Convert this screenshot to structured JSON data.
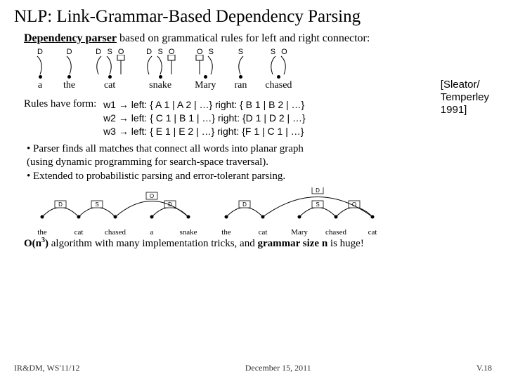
{
  "title": "NLP: Link-Grammar-Based Dependency Parsing",
  "subtitle_bold": "Dependency parser",
  "subtitle_rest": " based on grammatical rules for left and right connector:",
  "citation": "[Sleator/\nTemperley\n1991]",
  "words_row1": [
    {
      "label": "a",
      "conns": [
        {
          "dir": "r",
          "lbl": "D"
        }
      ]
    },
    {
      "label": "the",
      "conns": [
        {
          "dir": "r",
          "lbl": "D"
        }
      ]
    },
    {
      "label": "cat",
      "conns": [
        {
          "dir": "l",
          "lbl": "D"
        },
        {
          "dir": "r",
          "lbl": "S"
        },
        {
          "dir": "top",
          "lbl": "O"
        }
      ]
    },
    {
      "label": "snake",
      "conns": [
        {
          "dir": "l",
          "lbl": "D"
        },
        {
          "dir": "r",
          "lbl": "S"
        },
        {
          "dir": "top",
          "lbl": "O"
        }
      ]
    },
    {
      "label": "Mary",
      "conns": [
        {
          "dir": "top",
          "lbl": "O"
        },
        {
          "dir": "r",
          "lbl": "S"
        }
      ]
    },
    {
      "label": "ran",
      "conns": [
        {
          "dir": "l",
          "lbl": "S"
        }
      ]
    },
    {
      "label": "chased",
      "conns": [
        {
          "dir": "l",
          "lbl": "S"
        },
        {
          "dir": "r",
          "lbl": "O"
        }
      ]
    }
  ],
  "rules_lead": "Rules have form:",
  "rules": [
    "w1 → left: { A 1 | A 2 | …}  right: { B 1 | B 2 | …}",
    "w2 → left: { C 1 | B 1 | …}  right: {D 1 | D 2 | …}",
    "w3 → left: { E 1 | E 2 | …}  right: {F 1 | C 1 | …}"
  ],
  "bullets": [
    "• Parser finds all matches that connect all words into planar graph",
    "   (using dynamic programming for search-space traversal).",
    "• Extended to probabilistic parsing and error-tolerant parsing."
  ],
  "parse1": {
    "words": [
      "the",
      "cat",
      "chased",
      "a",
      "snake"
    ],
    "arcs": [
      {
        "from": 0,
        "to": 1,
        "lbl": "D"
      },
      {
        "from": 1,
        "to": 2,
        "lbl": "S"
      },
      {
        "from": 3,
        "to": 4,
        "lbl": "D"
      },
      {
        "from": 2,
        "to": 4,
        "lbl": "O"
      }
    ]
  },
  "parse2": {
    "words": [
      "the",
      "cat",
      "Mary",
      "chased",
      "cat"
    ],
    "arcs": [
      {
        "from": 0,
        "to": 1,
        "lbl": "D"
      },
      {
        "from": 2,
        "to": 3,
        "lbl": "S"
      },
      {
        "from": 3,
        "to": 4,
        "lbl": "O"
      },
      {
        "from": 1,
        "to": 4,
        "lbl": "D",
        "high": true
      }
    ]
  },
  "complexity_html": [
    "O(n",
    "3",
    ")",
    " algorithm with many implementation tricks, and ",
    "grammar size n",
    " is huge!"
  ],
  "footer_left": "IR&DM, WS'11/12",
  "footer_center": "December 15, 2011",
  "footer_right": "V.18"
}
